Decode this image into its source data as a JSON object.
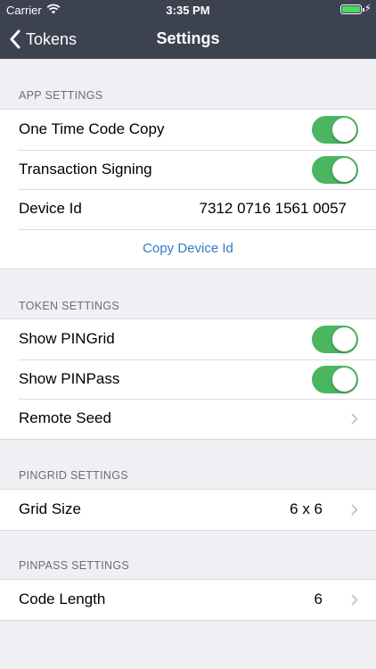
{
  "status_bar": {
    "carrier": "Carrier",
    "time": "3:35 PM"
  },
  "nav": {
    "back_label": "Tokens",
    "title": "Settings"
  },
  "sections": {
    "app": {
      "header": "APP SETTINGS",
      "one_time_code_copy": {
        "label": "One Time Code Copy",
        "on": true
      },
      "transaction_signing": {
        "label": "Transaction Signing",
        "on": true
      },
      "device_id": {
        "label": "Device Id",
        "value": "7312 0716 1561 0057"
      },
      "copy_device_id": "Copy Device Id"
    },
    "token": {
      "header": "TOKEN SETTINGS",
      "show_pingrid": {
        "label": "Show PINGrid",
        "on": true
      },
      "show_pinpass": {
        "label": "Show PINPass",
        "on": true
      },
      "remote_seed": {
        "label": "Remote Seed"
      }
    },
    "pingrid": {
      "header": "PINGRID SETTINGS",
      "grid_size": {
        "label": "Grid Size",
        "value": "6 x 6"
      }
    },
    "pinpass": {
      "header": "PINPASS SETTINGS",
      "code_length": {
        "label": "Code Length",
        "value": "6"
      }
    }
  },
  "colors": {
    "nav_background": "#3d4251",
    "toggle_on": "#4cb560",
    "link": "#2a7ec7",
    "page_background": "#efeff4"
  }
}
